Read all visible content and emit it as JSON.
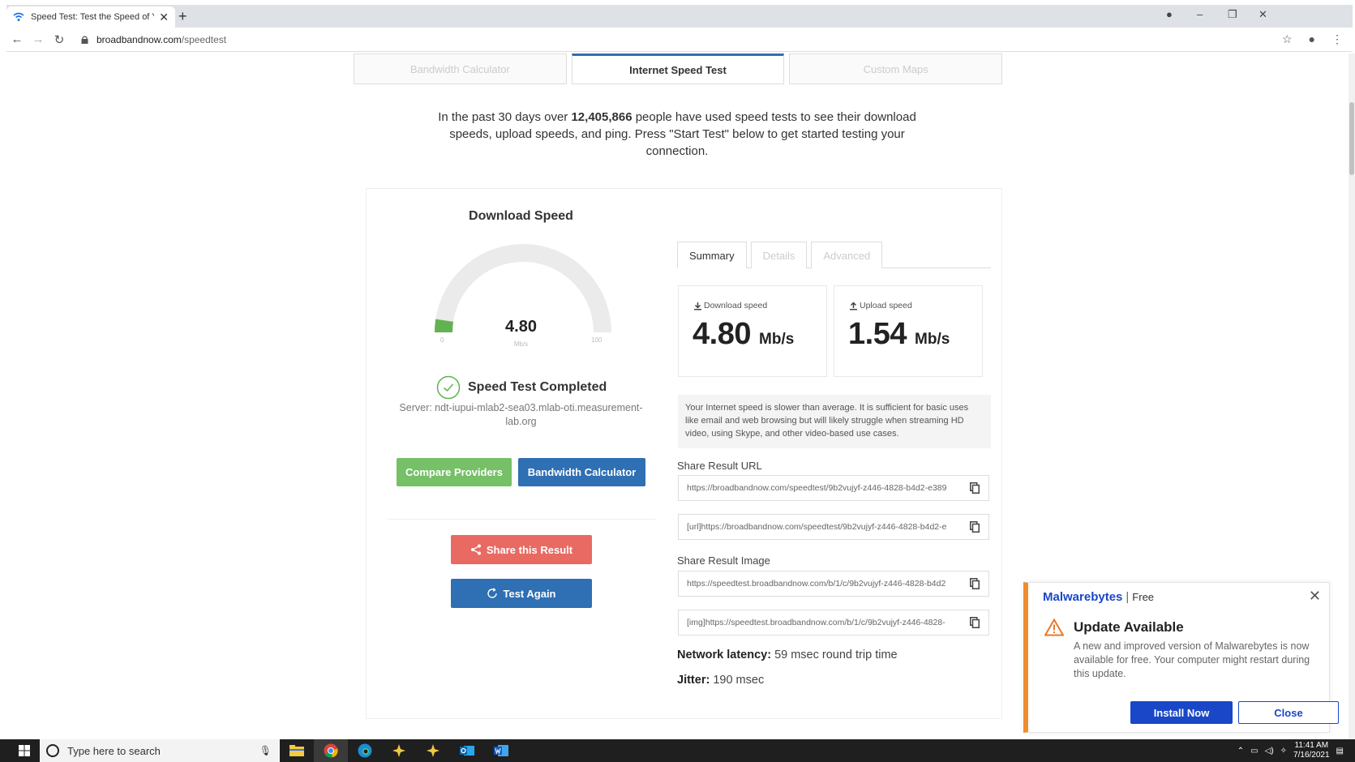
{
  "browser": {
    "tab_title": "Speed Test: Test the Speed of You",
    "url_host": "broadbandnow.com",
    "url_path": "/speedtest"
  },
  "page": {
    "tabs": [
      {
        "label": "Bandwidth Calculator"
      },
      {
        "label": "Internet Speed Test"
      },
      {
        "label": "Custom Maps"
      }
    ],
    "intro_before": "In the past 30 days over ",
    "intro_count": "12,405,866",
    "intro_after": " people have used speed tests to see their download speeds, upload speeds, and ping. Press \"Start Test\" below to get started testing your connection."
  },
  "gauge": {
    "title": "Download Speed",
    "value": "4.80",
    "unit": "Mb/s",
    "min": "0",
    "max": "100",
    "fraction": 0.048
  },
  "status": {
    "completed": "Speed Test Completed",
    "server": "Server: ndt-iupui-mlab2-sea03.mlab-oti.measurement-lab.org"
  },
  "buttons": {
    "compare": "Compare Providers",
    "bandwidth": "Bandwidth Calculator",
    "share": "Share this Result",
    "again": "Test Again"
  },
  "results": {
    "tabs": [
      {
        "label": "Summary"
      },
      {
        "label": "Details"
      },
      {
        "label": "Advanced"
      }
    ],
    "download_label": "Download speed",
    "download_value": "4.80",
    "download_unit": "Mb/s",
    "upload_label": "Upload speed",
    "upload_value": "1.54",
    "upload_unit": "Mb/s",
    "info": "Your Internet speed is slower than average. It is sufficient for basic uses like email and web browsing but will likely struggle when streaming HD video, using Skype, and other video-based use cases.",
    "share_url_label": "Share Result URL",
    "share_url_1": "https://broadbandnow.com/speedtest/9b2vujyf-z446-4828-b4d2-e389",
    "share_url_2": "[url]https://broadbandnow.com/speedtest/9b2vujyf-z446-4828-b4d2-e",
    "share_img_label": "Share Result Image",
    "share_img_1": "https://speedtest.broadbandnow.com/b/1/c/9b2vujyf-z446-4828-b4d2",
    "share_img_2": "[img]https://speedtest.broadbandnow.com/b/1/c/9b2vujyf-z446-4828-",
    "latency_label": "Network latency:",
    "latency_value": " 59 msec round trip time",
    "jitter_label": "Jitter:",
    "jitter_value": " 190 msec"
  },
  "malwarebytes": {
    "brand": "Malwarebytes",
    "edition": "Free",
    "title": "Update Available",
    "message": "A new and improved version of Malwarebytes is now available for free. Your computer might restart during this update.",
    "install": "Install Now",
    "close": "Close"
  },
  "taskbar": {
    "search_placeholder": "Type here to search",
    "time": "11:41 AM",
    "date": "7/16/2021"
  },
  "colors": {
    "accent_blue": "#2f6fb3",
    "green": "#76c068",
    "share_red": "#e86a62",
    "mb_blue": "#1a47c8",
    "mb_orange": "#f08c2f"
  }
}
